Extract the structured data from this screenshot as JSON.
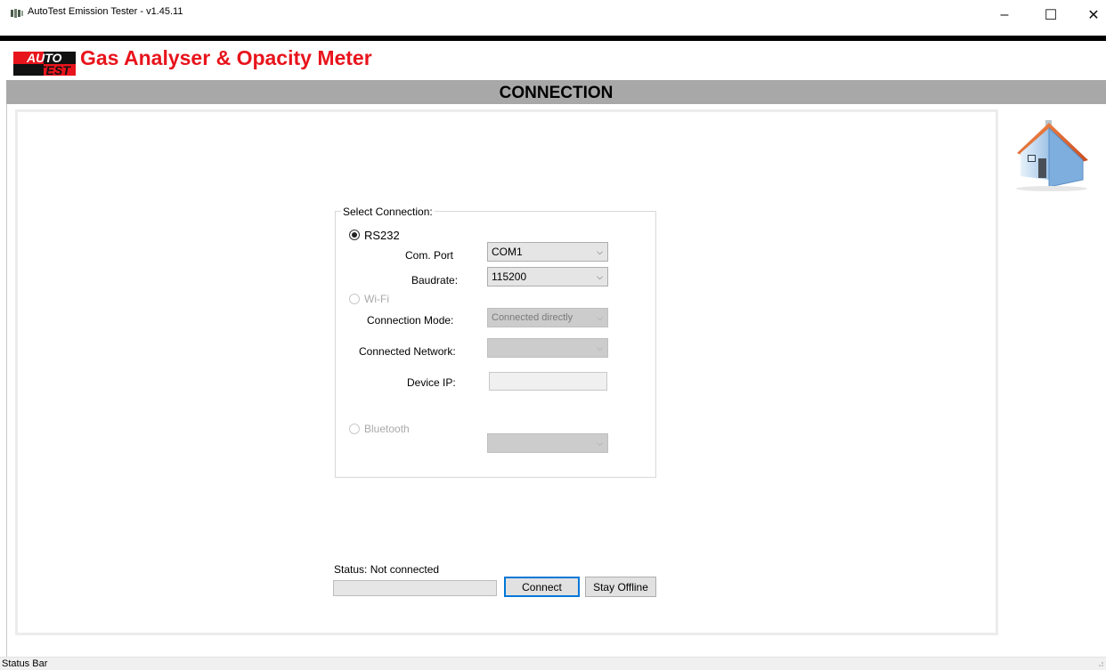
{
  "window": {
    "title": "AutoTest Emission Tester - v1.45.11",
    "controls": {
      "minimize": "–",
      "maximize": "☐",
      "close": "✕"
    }
  },
  "header": {
    "logo_line1": "AUTO",
    "logo_line2": "TEST",
    "app_title": "Gas Analyser & Opacity Meter",
    "section_title": "CONNECTION",
    "home_icon": "house-icon"
  },
  "connection": {
    "group_title": "Select Connection:",
    "rs232": {
      "label": "RS232",
      "selected": true,
      "com_port_label": "Com. Port",
      "com_port_value": "COM1",
      "baudrate_label": "Baudrate:",
      "baudrate_value": "115200"
    },
    "wifi": {
      "label": "Wi-Fi",
      "enabled": false,
      "mode_label": "Connection Mode:",
      "mode_value": "Connected directly",
      "network_label": "Connected Network:",
      "network_value": "",
      "ip_label": "Device IP:",
      "ip_value": ""
    },
    "bluetooth": {
      "label": "Bluetooth",
      "enabled": false,
      "device_value": ""
    }
  },
  "status": {
    "text": "Status: Not connected",
    "progress": 0
  },
  "buttons": {
    "connect": "Connect",
    "stay_offline": "Stay Offline"
  },
  "status_bar": {
    "text": "Status Bar"
  },
  "colors": {
    "title_red": "#e8141c",
    "section_gray": "#a8a8a8",
    "focus_blue": "#0078d7"
  }
}
